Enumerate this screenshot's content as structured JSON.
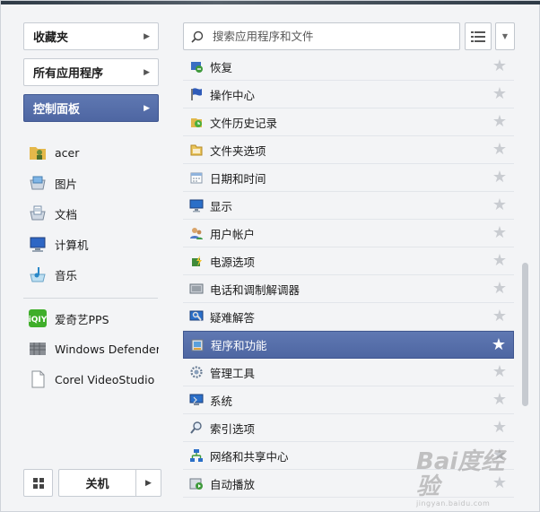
{
  "left": {
    "nav": [
      {
        "label": "收藏夹",
        "active": false
      },
      {
        "label": "所有应用程序",
        "active": false
      },
      {
        "label": "控制面板",
        "active": true
      }
    ],
    "places": [
      {
        "label": "acer",
        "icon": "user-folder-icon"
      },
      {
        "label": "图片",
        "icon": "pictures-icon"
      },
      {
        "label": "文档",
        "icon": "documents-icon"
      },
      {
        "label": "计算机",
        "icon": "computer-icon"
      },
      {
        "label": "音乐",
        "icon": "music-icon"
      }
    ],
    "apps": [
      {
        "label": "爱奇艺PPS",
        "icon": "iqiyi-icon"
      },
      {
        "label": "Windows Defender",
        "icon": "defender-icon"
      },
      {
        "label": "Corel VideoStudio Pro",
        "icon": "file-icon"
      }
    ],
    "power": {
      "label": "关机"
    }
  },
  "right": {
    "search": {
      "placeholder": "搜索应用程序和文件"
    },
    "items": [
      {
        "label": "恢复",
        "icon": "recovery-icon",
        "selected": false
      },
      {
        "label": "操作中心",
        "icon": "action-center-flag-icon",
        "selected": false
      },
      {
        "label": "文件历史记录",
        "icon": "file-history-icon",
        "selected": false
      },
      {
        "label": "文件夹选项",
        "icon": "folder-options-icon",
        "selected": false
      },
      {
        "label": "日期和时间",
        "icon": "date-time-icon",
        "selected": false
      },
      {
        "label": "显示",
        "icon": "display-icon",
        "selected": false
      },
      {
        "label": "用户帐户",
        "icon": "user-accounts-icon",
        "selected": false
      },
      {
        "label": "电源选项",
        "icon": "power-options-icon",
        "selected": false
      },
      {
        "label": "电话和调制解调器",
        "icon": "phone-modem-icon",
        "selected": false
      },
      {
        "label": "疑难解答",
        "icon": "troubleshooting-icon",
        "selected": false
      },
      {
        "label": "程序和功能",
        "icon": "programs-features-icon",
        "selected": true
      },
      {
        "label": "管理工具",
        "icon": "admin-tools-icon",
        "selected": false
      },
      {
        "label": "系统",
        "icon": "system-icon",
        "selected": false
      },
      {
        "label": "索引选项",
        "icon": "indexing-icon",
        "selected": false
      },
      {
        "label": "网络和共享中心",
        "icon": "network-icon",
        "selected": false
      },
      {
        "label": "自动播放",
        "icon": "autoplay-icon",
        "selected": false
      }
    ]
  },
  "watermark": {
    "brand": "Bai度经验",
    "url": "jingyan.baidu.com"
  },
  "colors": {
    "accent": "#4e66a2",
    "background": "#f3f4f6",
    "star_inactive": "#c9ccd1"
  }
}
